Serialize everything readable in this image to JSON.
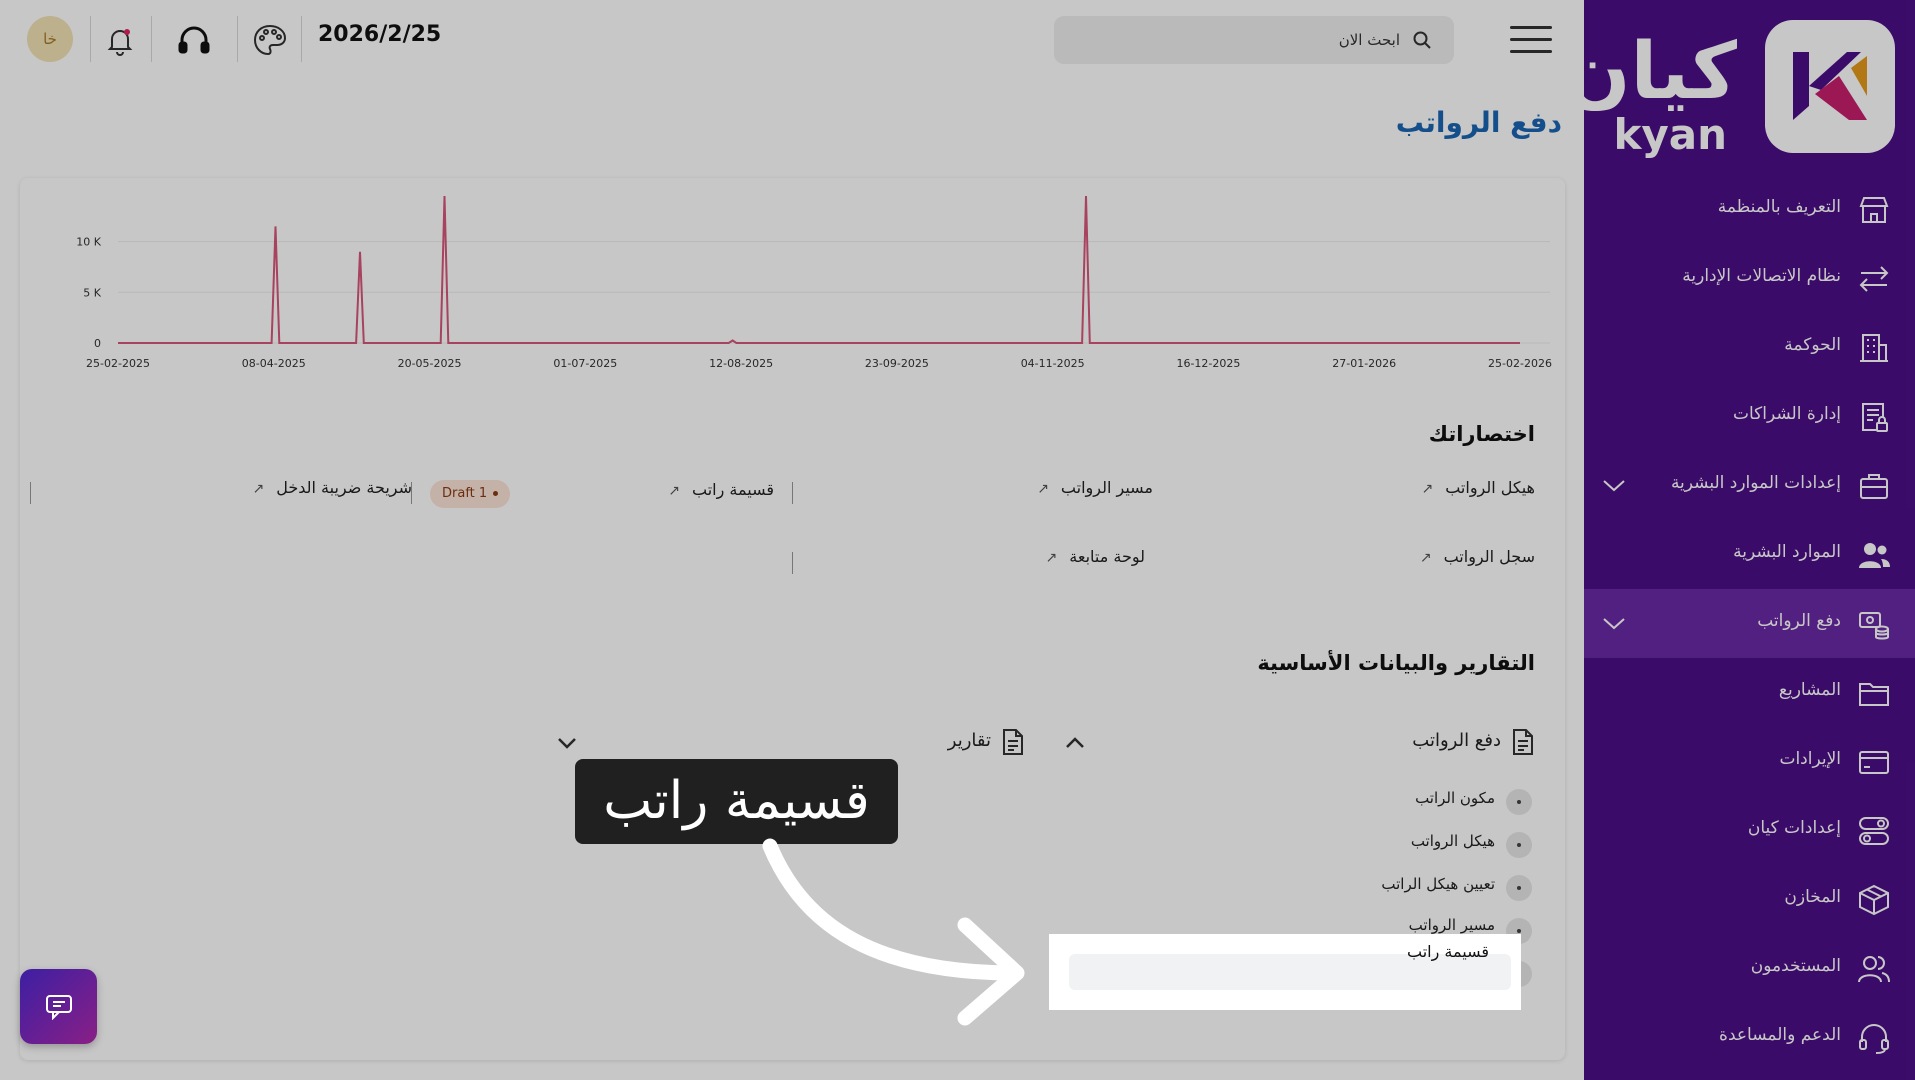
{
  "brand": {
    "name_ar": "كيان",
    "name_en": "kyan",
    "colors": {
      "sidebar": "#4b0f86",
      "active": "#6a2aa6",
      "title": "#1c66b3",
      "chart_line": "#d6557a"
    }
  },
  "sidebar": {
    "items": [
      {
        "label": "التعريف بالمنظمة",
        "icon": "store-icon",
        "active": false,
        "expandable": false
      },
      {
        "label": "نظام الاتصالات الإدارية",
        "icon": "arrows-swap-icon",
        "active": false,
        "expandable": false
      },
      {
        "label": "الحوكمة",
        "icon": "building-icon",
        "active": false,
        "expandable": false
      },
      {
        "label": "إدارة الشراكات",
        "icon": "document-lock-icon",
        "active": false,
        "expandable": false
      },
      {
        "label": "إعدادات الموارد البشرية",
        "icon": "briefcase-icon",
        "active": false,
        "expandable": true
      },
      {
        "label": "الموارد البشرية",
        "icon": "users-icon",
        "active": false,
        "expandable": false
      },
      {
        "label": "دفع الرواتب",
        "icon": "money-stack-icon",
        "active": true,
        "expandable": true
      },
      {
        "label": "المشاريع",
        "icon": "folder-icon",
        "active": false,
        "expandable": false
      },
      {
        "label": "الإيرادات",
        "icon": "card-icon",
        "active": false,
        "expandable": false
      },
      {
        "label": "إعدادات كيان",
        "icon": "toggles-icon",
        "active": false,
        "expandable": false
      },
      {
        "label": "المخازن",
        "icon": "box-icon",
        "active": false,
        "expandable": false
      },
      {
        "label": "المستخدمون",
        "icon": "user-group-icon",
        "active": false,
        "expandable": false
      },
      {
        "label": "الدعم والمساعدة",
        "icon": "headset-icon",
        "active": false,
        "expandable": false
      }
    ]
  },
  "header": {
    "search_placeholder": "ابحث الان",
    "date": "2026/2/25",
    "avatar_initials": "خا"
  },
  "main": {
    "page_title": "دفع الرواتب",
    "shortcuts_title": "اختصاراتك",
    "shortcuts": [
      {
        "label": "هيكل الرواتب"
      },
      {
        "label": "مسير الرواتب"
      },
      {
        "label": "قسيمة راتب"
      },
      {
        "label": "شريحة ضريبة الدخل"
      },
      {
        "label": "سجل الرواتب"
      },
      {
        "label": "لوحة متابعة"
      }
    ],
    "draft_badge": "Draft 1",
    "reports_title": "التقارير والبيانات الأساسية",
    "payroll_group": "دفع الرواتب",
    "reports_group": "تقارير",
    "payroll_items": [
      "مكون الراتب",
      "هيكل الرواتب",
      "تعيين هيكل الراتب",
      "مسير الرواتب",
      "قسيمة راتب"
    ]
  },
  "callout": {
    "text": "قسيمة راتب"
  },
  "chart_data": {
    "type": "line",
    "x_ticks": [
      "25-02-2025",
      "08-04-2025",
      "20-05-2025",
      "01-07-2025",
      "12-08-2025",
      "23-09-2025",
      "04-11-2025",
      "16-12-2025",
      "27-01-2026",
      "25-02-2026"
    ],
    "y_ticks": [
      "0",
      "5 K",
      "10 K"
    ],
    "ylim": [
      0,
      14500
    ],
    "series": [
      {
        "points": [
          [
            "2025-02-25",
            0
          ],
          [
            "2025-04-06",
            0
          ],
          [
            "2025-04-07",
            11500
          ],
          [
            "2025-04-08",
            0
          ],
          [
            "2025-04-28",
            0
          ],
          [
            "2025-04-29",
            9000
          ],
          [
            "2025-04-30",
            0
          ],
          [
            "2025-05-20",
            0
          ],
          [
            "2025-05-21",
            14500
          ],
          [
            "2025-05-22",
            0
          ],
          [
            "2025-08-03",
            0
          ],
          [
            "2025-08-04",
            250
          ],
          [
            "2025-08-05",
            0
          ],
          [
            "2025-11-03",
            0
          ],
          [
            "2025-11-04",
            14500
          ],
          [
            "2025-11-05",
            0
          ],
          [
            "2026-02-25",
            0
          ]
        ]
      }
    ],
    "grid": true
  }
}
